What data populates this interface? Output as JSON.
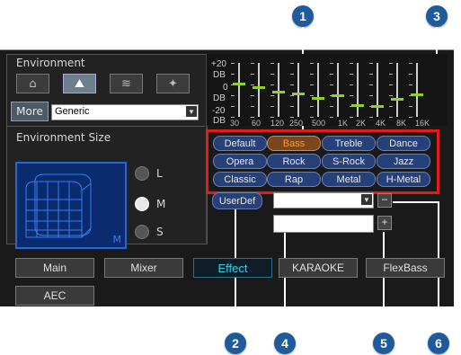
{
  "callouts": [
    "1",
    "2",
    "3",
    "4",
    "5",
    "6"
  ],
  "environment": {
    "label": "Environment",
    "buttons": [
      "room-icon",
      "mountain-icon",
      "hall-icon",
      "forest-icon"
    ],
    "active_button": 1,
    "more_label": "More",
    "preset_value": "Generic"
  },
  "env_size": {
    "label": "Environment Size",
    "room_corner": "M",
    "options": [
      "L",
      "M",
      "S"
    ],
    "selected": "M"
  },
  "equalizer": {
    "db_labels": [
      "+20",
      "DB",
      "0",
      "DB",
      "-20",
      "DB"
    ],
    "freqs": [
      "30",
      "60",
      "120",
      "250",
      "500",
      "1K",
      "2K",
      "4K",
      "8K",
      "16K"
    ],
    "levels": [
      0.62,
      0.55,
      0.45,
      0.42,
      0.33,
      0.38,
      0.2,
      0.18,
      0.32,
      0.4
    ],
    "knob_color": "#8fd12a"
  },
  "presets": {
    "items": [
      "Default",
      "Bass",
      "Treble",
      "Dance",
      "Opera",
      "Rock",
      "S-Rock",
      "Jazz",
      "Classic",
      "Rap",
      "Metal",
      "H-Metal"
    ],
    "selected": "Bass",
    "userdef_label": "UserDef"
  },
  "userdef_controls": {
    "minus_label": "−",
    "plus_label": "+",
    "dropdown_value": "",
    "name_value": ""
  },
  "tabs": {
    "items": [
      "Main",
      "Mixer",
      "Effect",
      "KARAOKE",
      "FlexBass",
      "AEC"
    ],
    "active": "Effect"
  },
  "colors": {
    "highlight_frame": "#e21c1c",
    "callout_bg": "#1e5a9c",
    "active_tab_text": "#35d2e6"
  }
}
